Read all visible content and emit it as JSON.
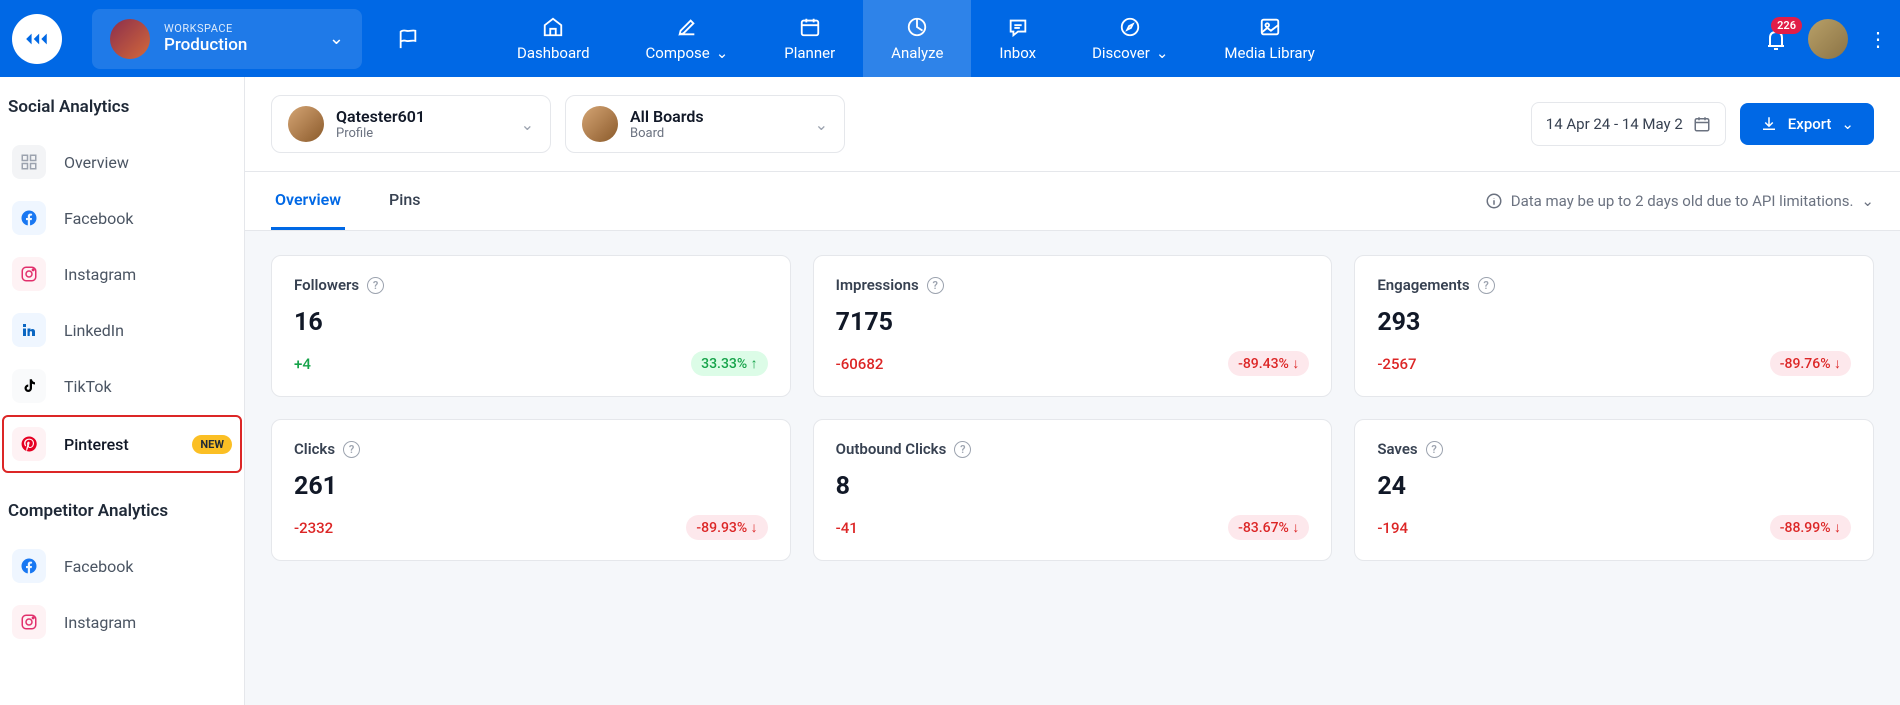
{
  "topnav": {
    "workspace_label": "WORKSPACE",
    "workspace_name": "Production",
    "items": [
      {
        "label": "Dashboard",
        "icon": "home"
      },
      {
        "label": "Compose",
        "icon": "edit",
        "chevron": true
      },
      {
        "label": "Planner",
        "icon": "calendar"
      },
      {
        "label": "Analyze",
        "icon": "chart",
        "active": true
      },
      {
        "label": "Inbox",
        "icon": "chat"
      },
      {
        "label": "Discover",
        "icon": "compass",
        "chevron": true
      },
      {
        "label": "Media Library",
        "icon": "image"
      }
    ],
    "notifications": "226"
  },
  "sidebar": {
    "section1_title": "Social Analytics",
    "section1_items": [
      {
        "label": "Overview",
        "icon": "overview"
      },
      {
        "label": "Facebook",
        "icon": "facebook"
      },
      {
        "label": "Instagram",
        "icon": "instagram"
      },
      {
        "label": "LinkedIn",
        "icon": "linkedin"
      },
      {
        "label": "TikTok",
        "icon": "tiktok"
      },
      {
        "label": "Pinterest",
        "icon": "pinterest",
        "badge": "NEW",
        "highlighted": true
      }
    ],
    "section2_title": "Competitor Analytics",
    "section2_items": [
      {
        "label": "Facebook",
        "icon": "facebook"
      },
      {
        "label": "Instagram",
        "icon": "instagram"
      }
    ]
  },
  "toolbar": {
    "profile_dropdown": {
      "title": "Qatester601",
      "sub": "Profile"
    },
    "board_dropdown": {
      "title": "All Boards",
      "sub": "Board"
    },
    "date_range": "14 Apr 24 - 14 May 2",
    "export_label": "Export"
  },
  "tabs": {
    "items": [
      {
        "label": "Overview",
        "active": true
      },
      {
        "label": "Pins"
      }
    ],
    "note": "Data may be up to 2 days old due to API limitations."
  },
  "metrics": [
    {
      "title": "Followers",
      "value": "16",
      "delta": "+4",
      "pct": "33.33% ↑",
      "positive": true
    },
    {
      "title": "Impressions",
      "value": "7175",
      "delta": "-60682",
      "pct": "-89.43% ↓",
      "positive": false
    },
    {
      "title": "Engagements",
      "value": "293",
      "delta": "-2567",
      "pct": "-89.76% ↓",
      "positive": false
    },
    {
      "title": "Clicks",
      "value": "261",
      "delta": "-2332",
      "pct": "-89.93% ↓",
      "positive": false
    },
    {
      "title": "Outbound Clicks",
      "value": "8",
      "delta": "-41",
      "pct": "-83.67% ↓",
      "positive": false
    },
    {
      "title": "Saves",
      "value": "24",
      "delta": "-194",
      "pct": "-88.99% ↓",
      "positive": false
    }
  ]
}
